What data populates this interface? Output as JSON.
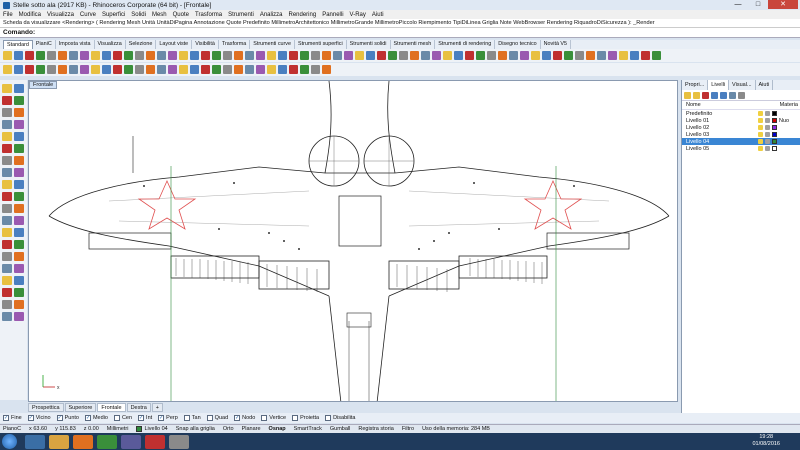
{
  "window": {
    "title": "Stelle sotto ala (2917 KB) - Rhinoceros Corporate (64 bit) - [Frontale]",
    "minimize": "—",
    "maximize": "□",
    "close": "✕"
  },
  "menu": [
    "File",
    "Modifica",
    "Visualizza",
    "Curve",
    "Superfici",
    "Solidi",
    "Mesh",
    "Quote",
    "Trasforma",
    "Strumenti",
    "Analizza",
    "Rendering",
    "Pannelli",
    "V-Ray",
    "Aiuti"
  ],
  "command": {
    "history": "Scheda da visualizzare <Rendering> ( Rendering  Mesh  Unità  UnitàDiPagina  Annotazione  Quote  Predefinito  MillimetroArchitettonico  MillimetroGrande  MillimetroPiccolo  Riempimento  TipiDiLinea  Griglia  Note  WebBrowser  Rendering  RiquadroDiSicurezza ): _Render",
    "prompt": "Comando:"
  },
  "toolbar_tabs": [
    "Standard",
    "PianiC",
    "Imposta vista",
    "Visualizza",
    "Selezione",
    "Layout viste",
    "Visibilità",
    "Trasforma",
    "Strumenti curve",
    "Strumenti superfici",
    "Strumenti solidi",
    "Strumenti mesh",
    "Strumenti di rendering",
    "Disegno tecnico",
    "Novità V5"
  ],
  "viewport": {
    "title": "Frontale",
    "axis_label": "x"
  },
  "view_tabs": [
    "Prospettica",
    "Superiore",
    "Frontale",
    "Destra",
    "+"
  ],
  "active_view_tab": "Frontale",
  "osnap": [
    {
      "label": "Fine",
      "checked": true
    },
    {
      "label": "Vicino",
      "checked": true
    },
    {
      "label": "Punto",
      "checked": true
    },
    {
      "label": "Medio",
      "checked": true
    },
    {
      "label": "Cen",
      "checked": false
    },
    {
      "label": "Int",
      "checked": true
    },
    {
      "label": "Perp",
      "checked": true
    },
    {
      "label": "Tan",
      "checked": false
    },
    {
      "label": "Quad",
      "checked": false
    },
    {
      "label": "Nodo",
      "checked": true
    },
    {
      "label": "Vertice",
      "checked": false
    },
    {
      "label": "Proietta",
      "checked": false
    },
    {
      "label": "Disabilita",
      "checked": false
    }
  ],
  "status": {
    "cplane": "PianoC",
    "x": "x 63.60",
    "y": "y 115.83",
    "z": "z 0.00",
    "units": "Millimetri",
    "current_layer": "Livello 04",
    "current_layer_color": "#2e8b3a",
    "toggles": [
      "Snap alla griglia",
      "Orto",
      "Planare",
      "Osnap",
      "SmartTrack",
      "Gumball",
      "Registra storia",
      "Filtro"
    ],
    "osnap_active": "Osnap",
    "memory": "Uso della memoria: 284 MB"
  },
  "panel": {
    "tabs": [
      "Propri...",
      "Livelli",
      "Visual...",
      "Aiuti"
    ],
    "active_tab": "Livelli",
    "col_name": "Nome",
    "col_material": "Materia",
    "layers": [
      {
        "name": "Predefinito",
        "color": "#000000",
        "material": "",
        "selected": false
      },
      {
        "name": "Livello 01",
        "color": "#cc0000",
        "material": "Nuo",
        "selected": false
      },
      {
        "name": "Livello 02",
        "color": "#8a2be2",
        "material": "",
        "selected": false
      },
      {
        "name": "Livello 03",
        "color": "#0000cc",
        "material": "",
        "selected": false
      },
      {
        "name": "Livello 04",
        "color": "#2e8b3a",
        "material": "",
        "selected": true
      },
      {
        "name": "Livello 05",
        "color": "#ffffff",
        "material": "",
        "selected": false
      }
    ]
  },
  "taskbar": {
    "time": "19:28",
    "date": "01/08/2016"
  }
}
